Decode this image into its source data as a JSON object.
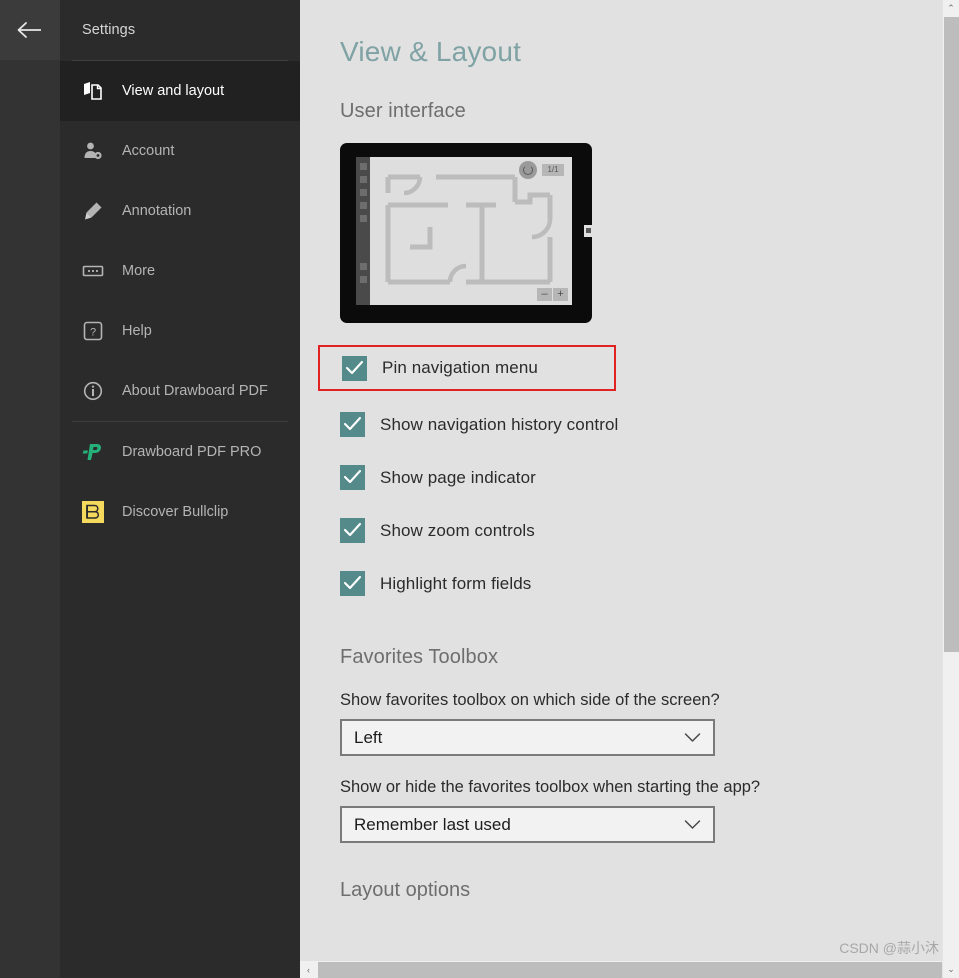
{
  "window": {
    "back_button": "back-arrow",
    "accent_teal": "#61898b",
    "checkbox_color": "#558a8a",
    "highlight_color": "#e02222"
  },
  "sidebar": {
    "title": "Settings",
    "items": [
      {
        "label": "View and layout",
        "icon": "view-layout-icon",
        "selected": true
      },
      {
        "label": "Account",
        "icon": "account-icon",
        "selected": false
      },
      {
        "label": "Annotation",
        "icon": "pen-icon",
        "selected": false
      },
      {
        "label": "More",
        "icon": "ellipsis-icon",
        "selected": false
      },
      {
        "label": "Help",
        "icon": "question-icon",
        "selected": false
      },
      {
        "label": "About Drawboard PDF",
        "icon": "info-icon",
        "selected": false
      },
      {
        "label": "Drawboard PDF PRO",
        "icon": "drawboard-pro-icon",
        "selected": false
      },
      {
        "label": "Discover Bullclip",
        "icon": "bullclip-icon",
        "selected": false
      }
    ]
  },
  "main": {
    "page_title": "View & Layout",
    "user_interface_heading": "User interface",
    "preview": {
      "page_indicator": "1/1",
      "zoom_out": "–",
      "zoom_in": "+",
      "history_icon": "navigation-history-icon"
    },
    "checkboxes": [
      {
        "label": "Pin navigation menu",
        "checked": true,
        "highlighted": true
      },
      {
        "label": "Show navigation history control",
        "checked": true,
        "highlighted": false
      },
      {
        "label": "Show page indicator",
        "checked": true,
        "highlighted": false
      },
      {
        "label": "Show zoom controls",
        "checked": true,
        "highlighted": false
      },
      {
        "label": "Highlight form fields",
        "checked": true,
        "highlighted": false
      }
    ],
    "favorites_heading": "Favorites Toolbox",
    "favorites_side": {
      "label": "Show favorites toolbox on which side of the screen?",
      "value": "Left"
    },
    "favorites_startup": {
      "label": "Show or hide the favorites toolbox when starting the app?",
      "value": "Remember last used"
    },
    "layout_options_heading": "Layout options"
  },
  "scroll": {
    "up_arrow": "⌃",
    "down_arrow": "⌄",
    "left_arrow": "‹"
  },
  "watermark": "CSDN @蒜小沐"
}
